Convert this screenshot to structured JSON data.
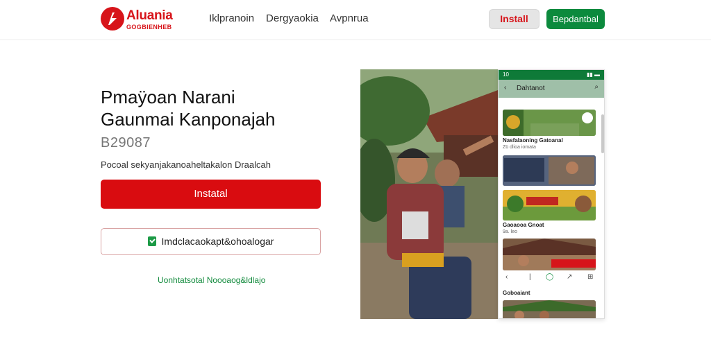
{
  "brand": {
    "name": "Aluania",
    "tagline": "GOGBIENHEB"
  },
  "nav": [
    "Iklpranoin",
    "Dergyaokia",
    "Avpnrua"
  ],
  "header_buttons": {
    "install": "Install",
    "secondary": "Bepdantbal"
  },
  "hero": {
    "title_line1": "Pmaÿoan Narani",
    "title_line2": "Gaunmai Kanponajah",
    "code": "B29087",
    "description": "Pocoal sekyanjakanoaheltakalon Draalcah",
    "install_button": "Instatal",
    "secondary_button": "Imdclacaokapt&ohoalogar",
    "link": "Uonhtatsotal Noooaog&ldlajo"
  },
  "phone": {
    "status_time": "10",
    "title": "Dahtanot",
    "cards": [
      {
        "caption": "Nasfalaoning Gatoanal",
        "sub": "Zü dlioa iomata"
      },
      {
        "caption": "",
        "sub": ""
      },
      {
        "caption": "Gaoaooa Gnoat",
        "sub": "9a. leo"
      },
      {
        "caption": "",
        "sub": ""
      }
    ],
    "section_label": "Goboaiant"
  },
  "colors": {
    "brand_red": "#d7141a",
    "brand_green": "#0c8a3d"
  }
}
